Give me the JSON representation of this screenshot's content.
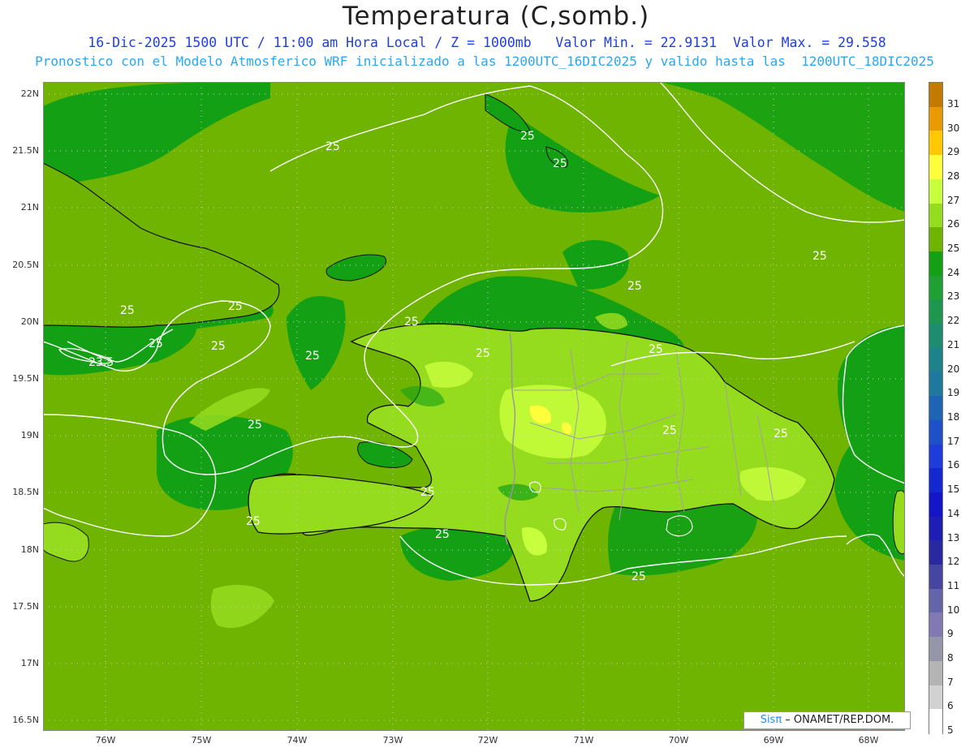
{
  "header": {
    "title": "Temperatura (C,somb.)",
    "subtitle1": "16-Dic-2025 1500 UTC / 11:00 am Hora Local / Z = 1000mb   Valor Min. = 22.9131  Valor Max. = 29.558",
    "subtitle2": "Pronostico con el Modelo Atmosferico WRF inicializado a las 1200UTC_16DIC2025 y valido hasta las  1200UTC_18DIC2025"
  },
  "axes": {
    "y_ticks": [
      "22N",
      "21.5N",
      "21N",
      "20.5N",
      "20N",
      "19.5N",
      "19N",
      "18.5N",
      "18N",
      "17.5N",
      "17N",
      "16.5N"
    ],
    "x_ticks": [
      "76W",
      "75W",
      "74W",
      "73W",
      "72W",
      "71W",
      "70W",
      "69W",
      "68W"
    ]
  },
  "colorbar": {
    "labels": [
      "31",
      "30",
      "29",
      "28",
      "27",
      "26",
      "25",
      "24",
      "23",
      "22",
      "21",
      "20",
      "19",
      "18",
      "17",
      "16",
      "15",
      "14",
      "13",
      "12",
      "11",
      "10",
      "9",
      "8",
      "7",
      "6",
      "5"
    ],
    "colors": [
      "#c47a00",
      "#e89a00",
      "#ffc800",
      "#ffff3c",
      "#c8ff3c",
      "#96dc1e",
      "#6eb400",
      "#14a014",
      "#1ea032",
      "#1e9650",
      "#1e8c6e",
      "#1e828c",
      "#1e78a0",
      "#1e64b4",
      "#1e50c8",
      "#1e3cdc",
      "#1428d2",
      "#1414c8",
      "#1e1eb4",
      "#2828a0",
      "#4646a0",
      "#6464aa",
      "#8278b4",
      "#9696aa",
      "#b4b4b4",
      "#d2d2d2",
      "#ffffff"
    ]
  },
  "map": {
    "contour_labels": [
      "25",
      "25",
      "25",
      "25",
      "25",
      "25",
      "25",
      "25",
      "25",
      "25",
      "25",
      "25",
      "25",
      "25",
      "25",
      "25",
      "25",
      "25",
      "25",
      "25",
      "23.5"
    ]
  },
  "credit": {
    "logo": "Sisπ",
    "text": " – ONAMET/REP.DOM."
  }
}
